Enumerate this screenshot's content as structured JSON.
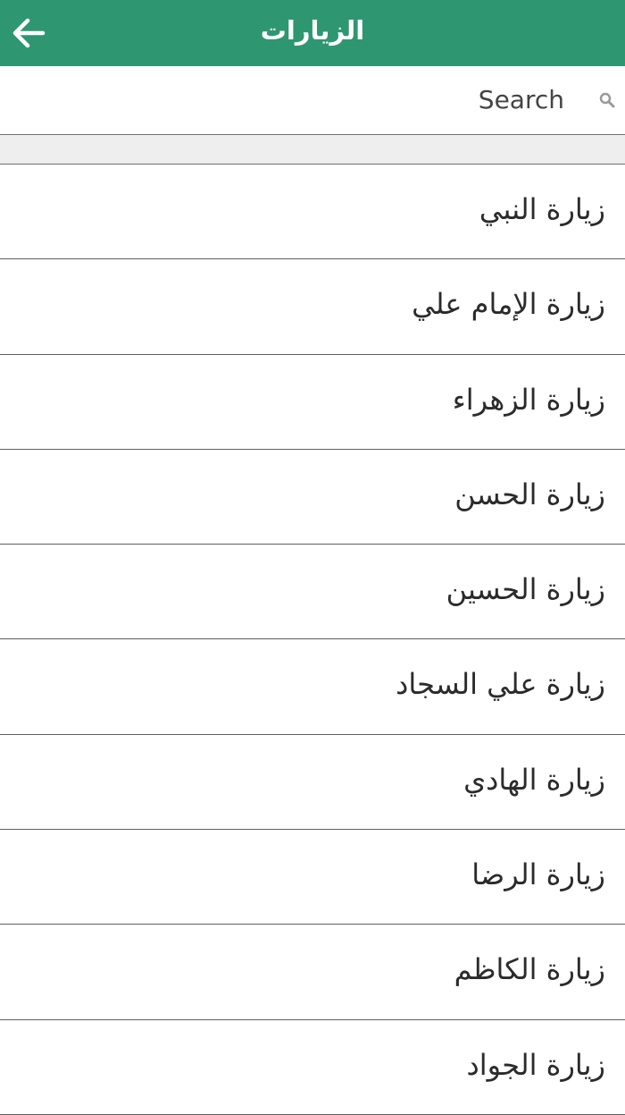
{
  "header": {
    "title": "الزيارات",
    "back_icon": "arrow-left-icon",
    "background_color": "#2f9672"
  },
  "search": {
    "placeholder": "Search",
    "value": "",
    "icon": "search-icon"
  },
  "list": {
    "items": [
      {
        "label": "زيارة النبي"
      },
      {
        "label": "زيارة الإمام علي"
      },
      {
        "label": "زيارة الزهراء"
      },
      {
        "label": "زيارة الحسن"
      },
      {
        "label": "زيارة الحسين"
      },
      {
        "label": "زيارة علي السجاد"
      },
      {
        "label": "زيارة الهادي"
      },
      {
        "label": "زيارة الرضا"
      },
      {
        "label": "زيارة الكاظم"
      },
      {
        "label": "زيارة الجواد"
      }
    ]
  }
}
